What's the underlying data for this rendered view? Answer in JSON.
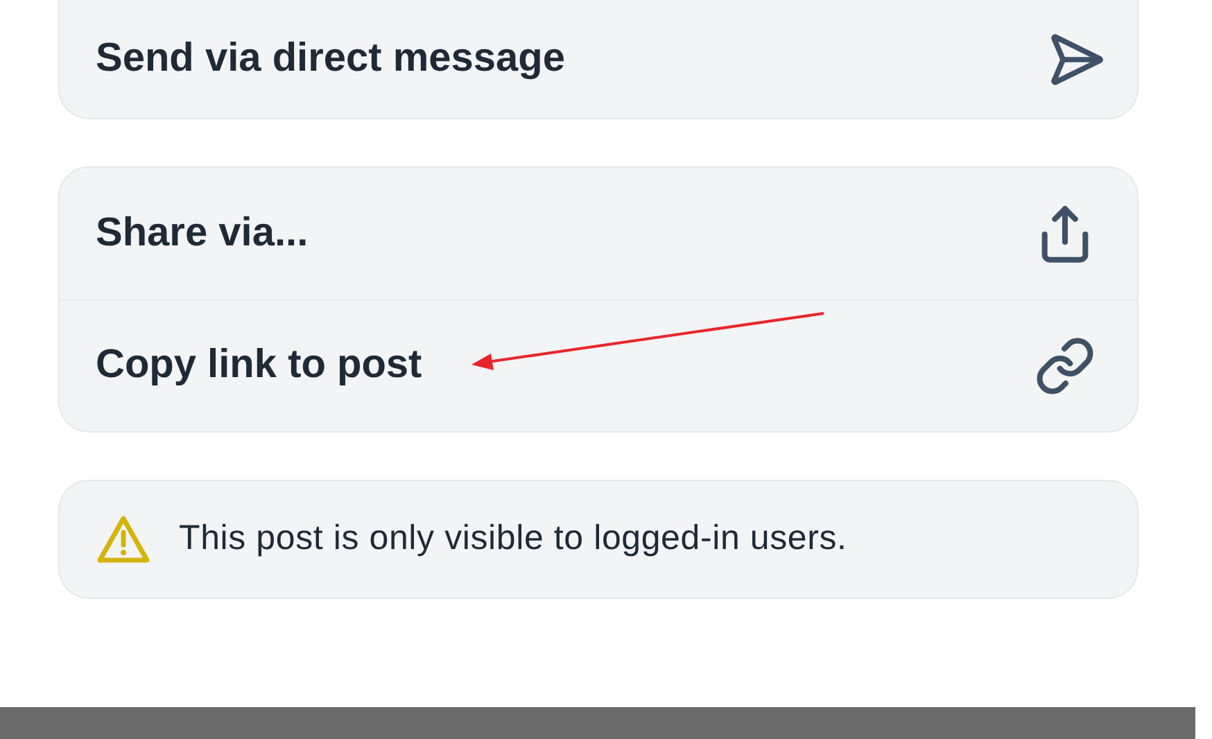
{
  "direct_message": {
    "label": "Send via direct message"
  },
  "share_actions": [
    {
      "label": "Share via...",
      "kind": "share"
    },
    {
      "label": "Copy link to post",
      "kind": "link"
    }
  ],
  "notice": {
    "text": "This post is only visible to logged-in users."
  },
  "annotation": {
    "kind": "arrow",
    "color": "#e8262a"
  }
}
